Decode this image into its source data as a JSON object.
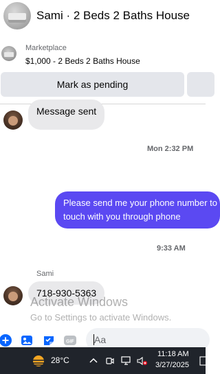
{
  "header": {
    "title": "Sami · 2 Beds 2 Baths House"
  },
  "listing": {
    "label": "Marketplace",
    "item": "$1,000 - 2 Beds 2 Baths House"
  },
  "actions": {
    "mark_pending": "Mark as pending"
  },
  "messages": {
    "system_sent": "Message sent",
    "time_1": "Mon 2:32 PM",
    "outgoing_line1": "Please send me your phone  number to get in",
    "outgoing_line2": "touch with you through phone",
    "time_2": "9:33 AM",
    "sender_name": "Sami",
    "incoming_phone": "718-930-5363"
  },
  "watermark": {
    "title": "Activate Windows",
    "subtitle": "Go to Settings to activate Windows."
  },
  "composer": {
    "placeholder": "Aa"
  },
  "taskbar": {
    "temperature": "28°C",
    "time": "11:18 AM",
    "date": "3/27/2025"
  },
  "colors": {
    "accent": "#5b49f2",
    "icon_blue": "#0866ff",
    "bubble_gray": "#e9e9eb",
    "taskbar": "#20242b"
  }
}
